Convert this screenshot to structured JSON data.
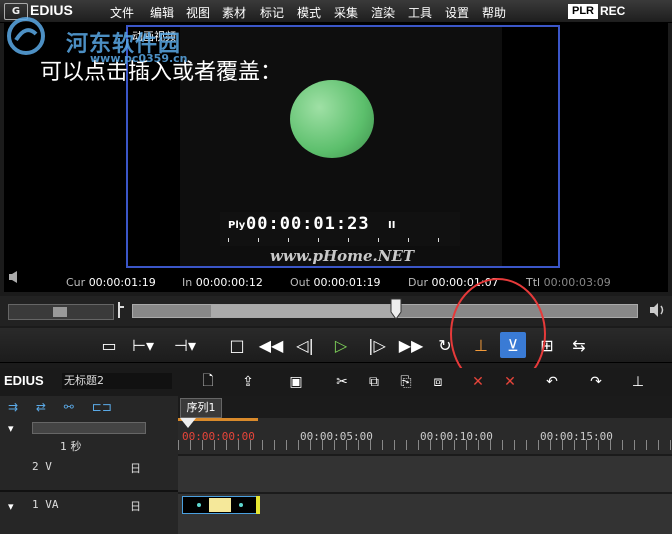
{
  "menubar": {
    "logo_badge": "G",
    "app_name": "EDIUS",
    "items": [
      "文件",
      "编辑",
      "视图",
      "素材",
      "标记",
      "模式",
      "采集",
      "渲染",
      "工具",
      "设置",
      "帮助"
    ],
    "plr": "PLR",
    "rec": "REC"
  },
  "watermark": {
    "name": "河东软件园",
    "url": "www.pc0359.cn"
  },
  "preview": {
    "clip_label": "动画视频",
    "caption": "可以点击插入或者覆盖：",
    "tc_ply": "Ply",
    "tc_value": "00:00:01:23",
    "tc_pause": "II",
    "site_watermark": "www.pHome.NET",
    "status": {
      "cur_label": "Cur",
      "cur": "00:00:01:19",
      "in_label": "In",
      "in": "00:00:00:12",
      "out_label": "Out",
      "out": "00:00:01:19",
      "dur_label": "Dur",
      "dur": "00:00:01:07",
      "ttl_label": "Ttl",
      "ttl": "00:00:03:09"
    }
  },
  "timeline": {
    "app": "EDIUS",
    "project": "无标题2",
    "sequence_tab": "序列1",
    "zoom": "1 秒",
    "ruler": [
      "00:00:00:00",
      "00:00:05:00",
      "00:00:10:00",
      "00:00:15:00"
    ],
    "tracks": [
      {
        "name": "2 V",
        "mark": "日"
      },
      {
        "name": "1 VA",
        "mark": "日"
      }
    ]
  },
  "colors": {
    "accent": "#3a7bd5",
    "highlight_circle": "#e63a3a",
    "safe_frame": "#3b56c8"
  }
}
